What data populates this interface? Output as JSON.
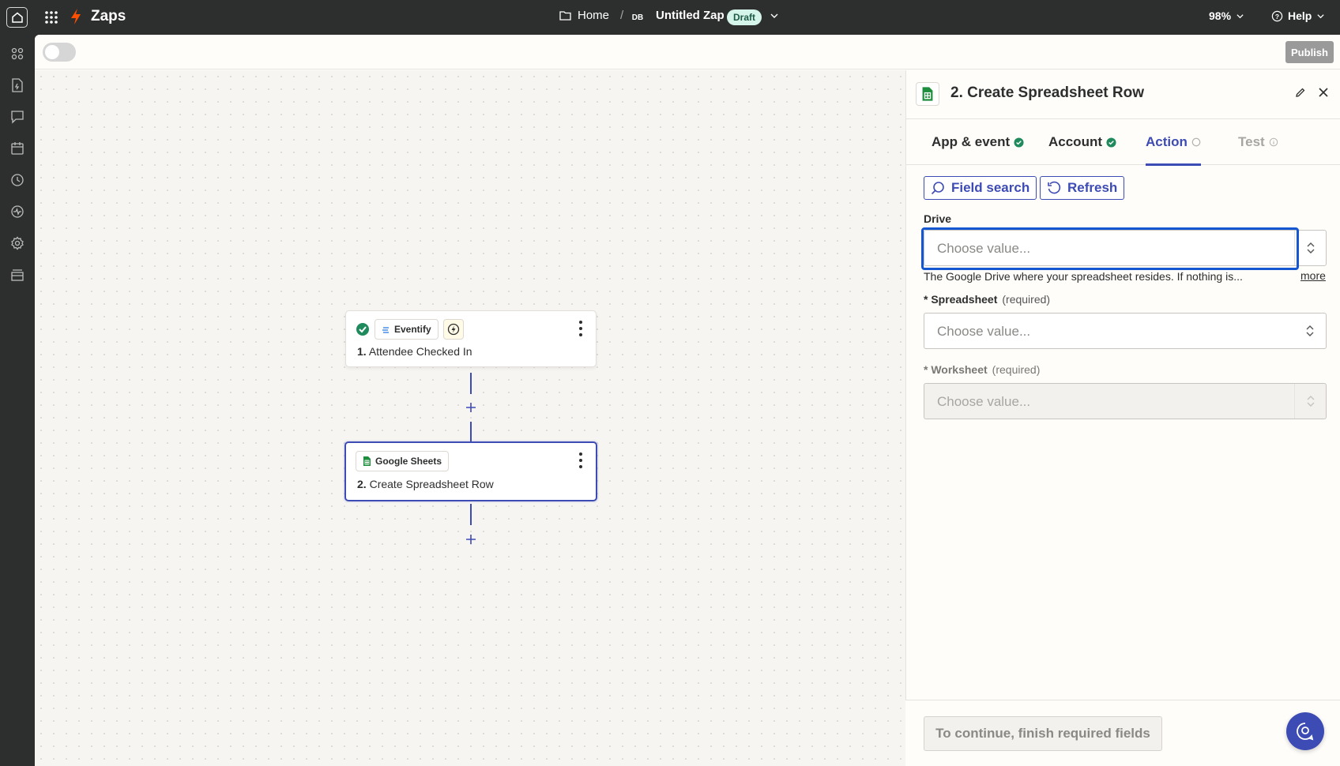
{
  "topbar": {
    "app_name": "Zaps",
    "breadcrumb_home": "Home",
    "breadcrumb_sep": "/",
    "avatar_initials": "DB",
    "zap_title": "Untitled Zap",
    "status_badge": "Draft",
    "zoom": "98%",
    "help": "Help"
  },
  "toolbar": {
    "publish_label": "Publish",
    "toggle_on": false
  },
  "canvas": {
    "steps": [
      {
        "number": "1.",
        "title": "Attendee Checked In",
        "app": "Eventify",
        "status": "complete"
      },
      {
        "number": "2.",
        "title": "Create Spreadsheet Row",
        "app": "Google Sheets",
        "status": "selected"
      }
    ]
  },
  "panel": {
    "title": "2. Create Spreadsheet Row",
    "tabs": [
      {
        "label": "App & event",
        "state": "complete"
      },
      {
        "label": "Account",
        "state": "complete"
      },
      {
        "label": "Action",
        "state": "active"
      },
      {
        "label": "Test",
        "state": "disabled"
      }
    ],
    "field_search_label": "Field search",
    "refresh_label": "Refresh",
    "fields": {
      "drive": {
        "label": "Drive",
        "placeholder": "Choose value...",
        "help": "The Google Drive where your spreadsheet resides. If nothing is...",
        "more": "more"
      },
      "spreadsheet": {
        "label": "* Spreadsheet",
        "note": "(required)",
        "placeholder": "Choose value..."
      },
      "worksheet": {
        "label": "* Worksheet",
        "note": "(required)",
        "placeholder": "Choose value..."
      }
    },
    "continue_label": "To continue, finish required fields"
  },
  "colors": {
    "accent": "#3d4bb4",
    "brand": "#ff4f00",
    "success": "#1f8a5b",
    "focus": "#1557d1",
    "sheets_green": "#1e8e3e"
  }
}
